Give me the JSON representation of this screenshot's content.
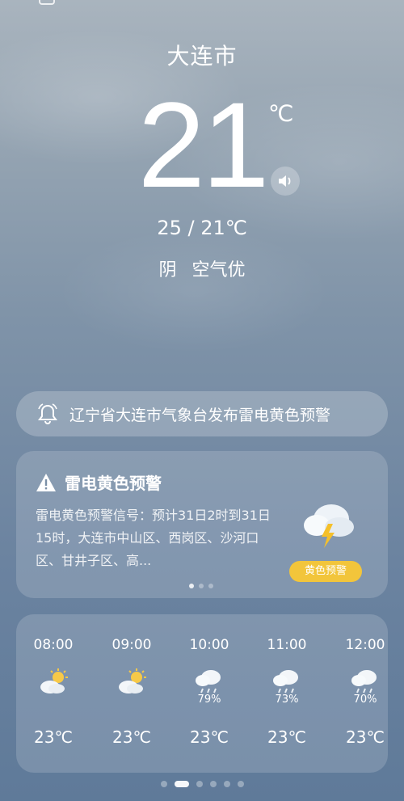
{
  "header": {
    "city": "大连市",
    "temperature": "21",
    "unit": "℃"
  },
  "summary": {
    "range": "25 / 21℃",
    "condition": "阴",
    "air_quality": "空气优"
  },
  "alert_bar": {
    "text": "辽宁省大连市气象台发布雷电黄色预警",
    "icon": "bell-icon"
  },
  "warning_card": {
    "title": "雷电黄色预警",
    "body": "雷电黄色预警信号：预计31日2时到31日15时，大连市中山区、西岗区、沙河口区、甘井子区、高...",
    "badge": "黄色预警",
    "badge_color": "#f2c53b",
    "icon": "thunderstorm-icon",
    "page_count": 3,
    "active_page": 1
  },
  "hourly": [
    {
      "time": "08:00",
      "icon": "partly-cloudy-icon",
      "precip": "",
      "temp": "23℃"
    },
    {
      "time": "09:00",
      "icon": "partly-cloudy-icon",
      "precip": "",
      "temp": "23℃"
    },
    {
      "time": "10:00",
      "icon": "light-rain-icon",
      "precip": "79%",
      "temp": "23℃"
    },
    {
      "time": "11:00",
      "icon": "light-rain-icon",
      "precip": "73%",
      "temp": "23℃"
    },
    {
      "time": "12:00",
      "icon": "light-rain-icon",
      "precip": "70%",
      "temp": "23℃"
    }
  ],
  "pager": {
    "count": 6,
    "active": 2
  }
}
